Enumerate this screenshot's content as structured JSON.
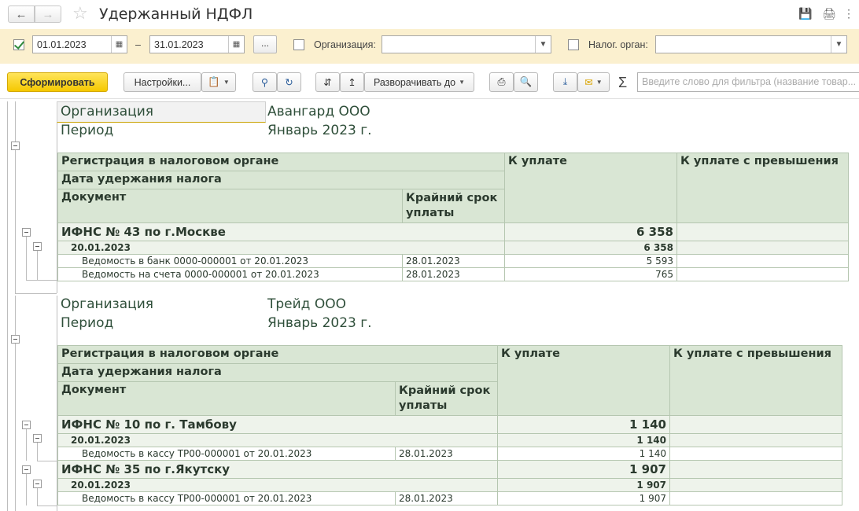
{
  "window": {
    "title": "Удержанный НДФЛ",
    "back_icon": "arrow-left-icon",
    "forward_icon": "arrow-right-icon"
  },
  "filters": {
    "period_enabled": true,
    "date_from": "01.01.2023",
    "dash": "–",
    "date_to": "31.01.2023",
    "period_more": "...",
    "organization_label": "Организация:",
    "organization_value": "",
    "tax_authority_label": "Налог. орган:",
    "tax_authority_value": ""
  },
  "toolbar": {
    "generate": "Сформировать",
    "settings": "Настройки...",
    "expand_to": "Разворачивать до",
    "sum_icon": "sigma-icon",
    "search_placeholder": "Введите слово для фильтра (название товар..."
  },
  "report": {
    "sections": [
      {
        "org_label": "Организация",
        "org_value": "Авангард ООО",
        "period_label": "Период",
        "period_value": "Январь 2023 г.",
        "headers": {
          "registration": "Регистрация в налоговом органе",
          "withholding_date": "Дата удержания налога",
          "document": "Документ",
          "deadline": "Крайний срок уплаты",
          "to_pay": "К уплате",
          "to_pay_excess": "К уплате с превышения"
        },
        "groups": [
          {
            "name": "ИФНС № 43 по г.Москве",
            "amount": "6 358",
            "date": "20.01.2023",
            "date_amount": "6 358",
            "rows": [
              {
                "document": "Ведомость в банк 0000-000001 от 20.01.2023",
                "deadline": "28.01.2023",
                "amount": "5 593"
              },
              {
                "document": "Ведомость на счета 0000-000001 от 20.01.2023",
                "deadline": "28.01.2023",
                "amount": "765"
              }
            ]
          }
        ]
      },
      {
        "org_label": "Организация",
        "org_value": "Трейд ООО",
        "period_label": "Период",
        "period_value": "Январь 2023 г.",
        "headers": {
          "registration": "Регистрация в налоговом органе",
          "withholding_date": "Дата удержания налога",
          "document": "Документ",
          "deadline": "Крайний срок уплаты",
          "to_pay": "К уплате",
          "to_pay_excess": "К уплате с превышения"
        },
        "groups": [
          {
            "name": "ИФНС № 10 по г. Тамбову",
            "amount": "1 140",
            "date": "20.01.2023",
            "date_amount": "1 140",
            "rows": [
              {
                "document": "Ведомость в кассу ТР00-000001 от 20.01.2023",
                "deadline": "28.01.2023",
                "amount": "1 140"
              }
            ]
          },
          {
            "name": "ИФНС № 35 по г.Якутску",
            "amount": "1 907",
            "date": "20.01.2023",
            "date_amount": "1 907",
            "rows": [
              {
                "document": "Ведомость в кассу ТР00-000001 от 20.01.2023",
                "deadline": "28.01.2023",
                "amount": "1 907"
              }
            ]
          }
        ]
      }
    ]
  }
}
